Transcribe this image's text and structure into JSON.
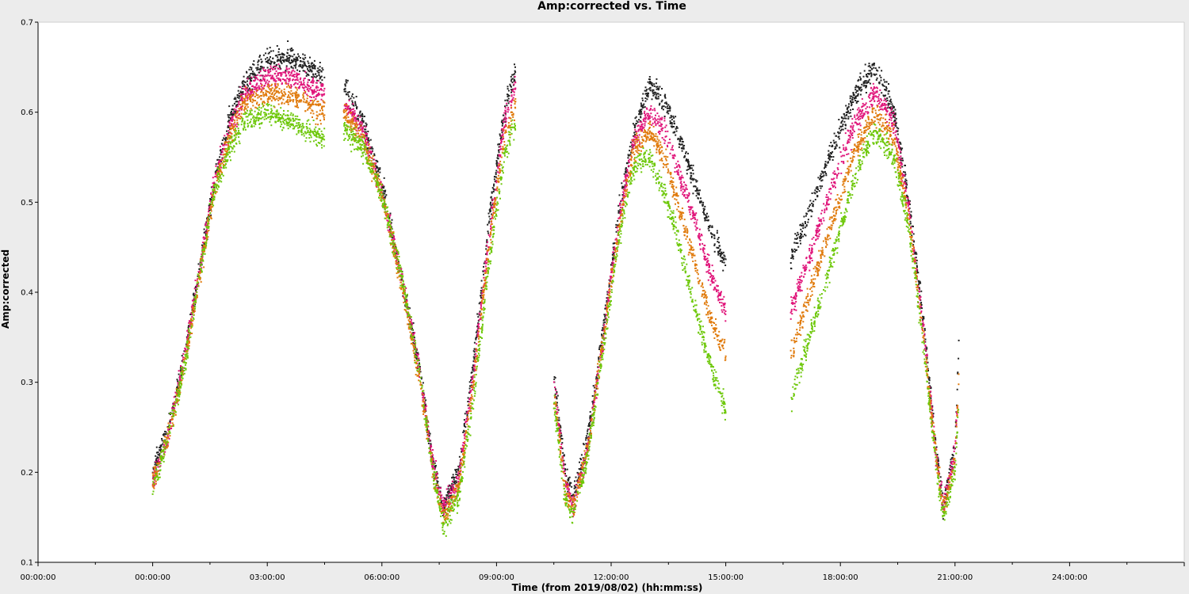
{
  "chart_data": {
    "type": "scatter",
    "title": "Amp:corrected vs. Time",
    "xlabel": "Time (from 2019/08/02) (hh:mm:ss)",
    "ylabel": "Amp:corrected",
    "xlim_hours": [
      -3.0,
      27.0
    ],
    "ylim": [
      0.1,
      0.7
    ],
    "x_ticks": [
      {
        "hours": -3,
        "label": "00:00:00"
      },
      {
        "hours": 0,
        "label": "00:00:00"
      },
      {
        "hours": 3,
        "label": "03:00:00"
      },
      {
        "hours": 6,
        "label": "06:00:00"
      },
      {
        "hours": 9,
        "label": "09:00:00"
      },
      {
        "hours": 12,
        "label": "12:00:00"
      },
      {
        "hours": 15,
        "label": "15:00:00"
      },
      {
        "hours": 18,
        "label": "18:00:00"
      },
      {
        "hours": 21,
        "label": "21:00:00"
      },
      {
        "hours": 24,
        "label": "24:00:00"
      }
    ],
    "y_ticks": [
      {
        "value": 0.1,
        "label": "0.1"
      },
      {
        "value": 0.2,
        "label": "0.2"
      },
      {
        "value": 0.3,
        "label": "0.3"
      },
      {
        "value": 0.4,
        "label": "0.4"
      },
      {
        "value": 0.5,
        "label": "0.5"
      },
      {
        "value": 0.6,
        "label": "0.6"
      },
      {
        "value": 0.7,
        "label": "0.7"
      }
    ],
    "grid": false,
    "legend": "none",
    "series": [
      {
        "color": "#222222",
        "segments": [
          {
            "points": [
              [
                0.0,
                0.2
              ],
              [
                0.4,
                0.25
              ],
              [
                0.8,
                0.32
              ],
              [
                1.2,
                0.42
              ],
              [
                1.6,
                0.52
              ],
              [
                2.0,
                0.59
              ],
              [
                2.4,
                0.63
              ],
              [
                3.0,
                0.66
              ],
              [
                3.6,
                0.66
              ],
              [
                4.0,
                0.65
              ],
              [
                4.5,
                0.64
              ]
            ]
          },
          {
            "points": [
              [
                5.0,
                0.63
              ],
              [
                5.5,
                0.59
              ],
              [
                6.0,
                0.52
              ],
              [
                6.5,
                0.42
              ],
              [
                7.0,
                0.31
              ],
              [
                7.3,
                0.22
              ],
              [
                7.6,
                0.16
              ],
              [
                8.0,
                0.2
              ],
              [
                8.4,
                0.32
              ],
              [
                8.8,
                0.48
              ],
              [
                9.2,
                0.6
              ],
              [
                9.5,
                0.65
              ]
            ]
          },
          {
            "points": [
              [
                10.5,
                0.31
              ],
              [
                10.8,
                0.2
              ],
              [
                11.0,
                0.17
              ],
              [
                11.4,
                0.24
              ],
              [
                11.8,
                0.36
              ],
              [
                12.2,
                0.49
              ],
              [
                12.6,
                0.58
              ],
              [
                13.0,
                0.63
              ],
              [
                13.4,
                0.61
              ],
              [
                13.8,
                0.57
              ],
              [
                14.2,
                0.52
              ],
              [
                14.6,
                0.47
              ],
              [
                15.0,
                0.43
              ]
            ]
          },
          {
            "points": [
              [
                16.7,
                0.44
              ],
              [
                17.2,
                0.49
              ],
              [
                17.8,
                0.56
              ],
              [
                18.4,
                0.62
              ],
              [
                18.9,
                0.65
              ],
              [
                19.4,
                0.6
              ],
              [
                19.8,
                0.5
              ],
              [
                20.2,
                0.36
              ],
              [
                20.5,
                0.23
              ],
              [
                20.7,
                0.16
              ],
              [
                21.0,
                0.23
              ],
              [
                21.1,
                0.34
              ]
            ]
          }
        ]
      },
      {
        "color": "#e0157a",
        "segments": [
          {
            "points": [
              [
                0.0,
                0.19
              ],
              [
                0.4,
                0.24
              ],
              [
                0.8,
                0.32
              ],
              [
                1.2,
                0.42
              ],
              [
                1.6,
                0.52
              ],
              [
                2.0,
                0.58
              ],
              [
                2.4,
                0.62
              ],
              [
                3.0,
                0.64
              ],
              [
                3.6,
                0.64
              ],
              [
                4.0,
                0.63
              ],
              [
                4.5,
                0.62
              ]
            ]
          },
          {
            "points": [
              [
                5.0,
                0.61
              ],
              [
                5.5,
                0.58
              ],
              [
                6.0,
                0.51
              ],
              [
                6.5,
                0.42
              ],
              [
                7.0,
                0.31
              ],
              [
                7.3,
                0.22
              ],
              [
                7.6,
                0.16
              ],
              [
                8.0,
                0.19
              ],
              [
                8.4,
                0.31
              ],
              [
                8.8,
                0.46
              ],
              [
                9.2,
                0.59
              ],
              [
                9.5,
                0.63
              ]
            ]
          },
          {
            "points": [
              [
                10.5,
                0.3
              ],
              [
                10.8,
                0.19
              ],
              [
                11.0,
                0.16
              ],
              [
                11.4,
                0.23
              ],
              [
                11.8,
                0.35
              ],
              [
                12.2,
                0.48
              ],
              [
                12.6,
                0.57
              ],
              [
                13.0,
                0.6
              ],
              [
                13.4,
                0.58
              ],
              [
                13.8,
                0.53
              ],
              [
                14.2,
                0.48
              ],
              [
                14.6,
                0.42
              ],
              [
                15.0,
                0.38
              ]
            ]
          },
          {
            "points": [
              [
                16.7,
                0.38
              ],
              [
                17.2,
                0.44
              ],
              [
                17.8,
                0.52
              ],
              [
                18.4,
                0.59
              ],
              [
                18.9,
                0.62
              ],
              [
                19.4,
                0.59
              ],
              [
                19.8,
                0.49
              ],
              [
                20.2,
                0.35
              ],
              [
                20.5,
                0.22
              ],
              [
                20.7,
                0.16
              ],
              [
                21.0,
                0.22
              ],
              [
                21.1,
                0.31
              ]
            ]
          }
        ]
      },
      {
        "color": "#e07b0d",
        "segments": [
          {
            "points": [
              [
                0.0,
                0.19
              ],
              [
                0.4,
                0.24
              ],
              [
                0.8,
                0.31
              ],
              [
                1.2,
                0.41
              ],
              [
                1.6,
                0.51
              ],
              [
                2.0,
                0.57
              ],
              [
                2.4,
                0.61
              ],
              [
                3.0,
                0.62
              ],
              [
                3.6,
                0.62
              ],
              [
                4.0,
                0.61
              ],
              [
                4.5,
                0.6
              ]
            ]
          },
          {
            "points": [
              [
                5.0,
                0.6
              ],
              [
                5.5,
                0.57
              ],
              [
                6.0,
                0.51
              ],
              [
                6.5,
                0.41
              ],
              [
                7.0,
                0.3
              ],
              [
                7.3,
                0.21
              ],
              [
                7.6,
                0.15
              ],
              [
                8.0,
                0.18
              ],
              [
                8.4,
                0.3
              ],
              [
                8.8,
                0.45
              ],
              [
                9.2,
                0.57
              ],
              [
                9.5,
                0.61
              ]
            ]
          },
          {
            "points": [
              [
                10.5,
                0.29
              ],
              [
                10.8,
                0.18
              ],
              [
                11.0,
                0.16
              ],
              [
                11.4,
                0.23
              ],
              [
                11.8,
                0.35
              ],
              [
                12.2,
                0.47
              ],
              [
                12.6,
                0.56
              ],
              [
                13.0,
                0.58
              ],
              [
                13.4,
                0.55
              ],
              [
                13.8,
                0.49
              ],
              [
                14.2,
                0.43
              ],
              [
                14.6,
                0.37
              ],
              [
                15.0,
                0.33
              ]
            ]
          },
          {
            "points": [
              [
                16.7,
                0.33
              ],
              [
                17.2,
                0.4
              ],
              [
                17.8,
                0.48
              ],
              [
                18.4,
                0.56
              ],
              [
                18.9,
                0.6
              ],
              [
                19.4,
                0.57
              ],
              [
                19.8,
                0.48
              ],
              [
                20.2,
                0.34
              ],
              [
                20.5,
                0.22
              ],
              [
                20.7,
                0.16
              ],
              [
                21.0,
                0.21
              ],
              [
                21.1,
                0.3
              ]
            ]
          }
        ]
      },
      {
        "color": "#6ec80b",
        "segments": [
          {
            "points": [
              [
                0.0,
                0.18
              ],
              [
                0.4,
                0.24
              ],
              [
                0.8,
                0.31
              ],
              [
                1.2,
                0.41
              ],
              [
                1.6,
                0.51
              ],
              [
                2.0,
                0.56
              ],
              [
                2.4,
                0.59
              ],
              [
                3.0,
                0.6
              ],
              [
                3.6,
                0.59
              ],
              [
                4.0,
                0.58
              ],
              [
                4.5,
                0.57
              ]
            ]
          },
          {
            "points": [
              [
                5.0,
                0.58
              ],
              [
                5.5,
                0.56
              ],
              [
                6.0,
                0.51
              ],
              [
                6.5,
                0.42
              ],
              [
                7.0,
                0.31
              ],
              [
                7.3,
                0.21
              ],
              [
                7.6,
                0.14
              ],
              [
                8.0,
                0.17
              ],
              [
                8.4,
                0.28
              ],
              [
                8.8,
                0.43
              ],
              [
                9.2,
                0.55
              ],
              [
                9.5,
                0.59
              ]
            ]
          },
          {
            "points": [
              [
                10.5,
                0.28
              ],
              [
                10.8,
                0.17
              ],
              [
                11.0,
                0.15
              ],
              [
                11.4,
                0.22
              ],
              [
                11.8,
                0.34
              ],
              [
                12.2,
                0.46
              ],
              [
                12.6,
                0.54
              ],
              [
                13.0,
                0.55
              ],
              [
                13.4,
                0.51
              ],
              [
                13.8,
                0.45
              ],
              [
                14.2,
                0.38
              ],
              [
                14.6,
                0.32
              ],
              [
                15.0,
                0.27
              ]
            ]
          },
          {
            "points": [
              [
                16.7,
                0.28
              ],
              [
                17.2,
                0.35
              ],
              [
                17.8,
                0.44
              ],
              [
                18.4,
                0.53
              ],
              [
                18.9,
                0.58
              ],
              [
                19.4,
                0.55
              ],
              [
                19.8,
                0.47
              ],
              [
                20.2,
                0.33
              ],
              [
                20.5,
                0.21
              ],
              [
                20.7,
                0.15
              ],
              [
                21.0,
                0.2
              ],
              [
                21.1,
                0.28
              ]
            ]
          }
        ]
      }
    ]
  }
}
